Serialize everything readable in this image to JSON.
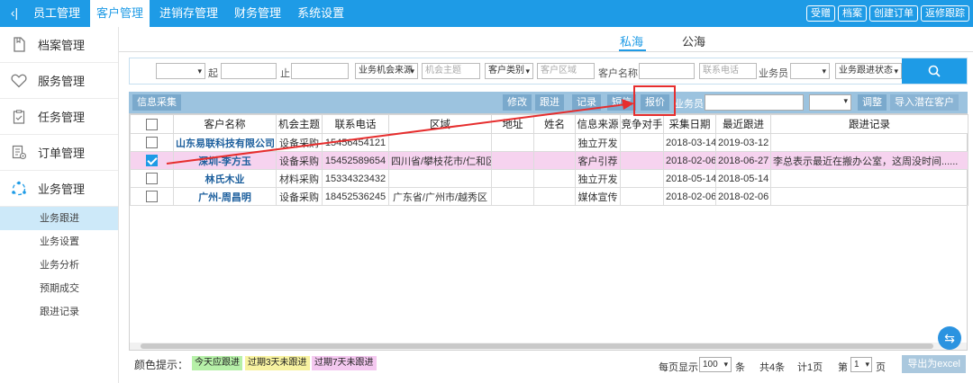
{
  "topbar": {
    "back_icon": "‹|",
    "nav": [
      "员工管理",
      "客户管理",
      "进销存管理",
      "财务管理",
      "系统设置"
    ],
    "active_nav": 1,
    "buttons": [
      "受赠",
      "档案",
      "创建订单",
      "返修跟踪"
    ]
  },
  "sidebar": {
    "items": [
      {
        "label": "档案管理",
        "icon": "document-icon"
      },
      {
        "label": "服务管理",
        "icon": "heart-icon"
      },
      {
        "label": "任务管理",
        "icon": "checklist-icon"
      },
      {
        "label": "订单管理",
        "icon": "order-icon"
      },
      {
        "label": "业务管理",
        "icon": "network-icon"
      }
    ],
    "submenu": [
      "业务跟进",
      "业务设置",
      "业务分析",
      "预期成交",
      "跟进记录"
    ]
  },
  "tabs": [
    "私海",
    "公海"
  ],
  "filter": {
    "date_from_label": "起",
    "date_to_label": "止",
    "source_select": "业务机会来源",
    "subject_placeholder": "机会主题",
    "category_select": "客户类别",
    "region_placeholder": "客户区域",
    "customer_name_label": "客户名称",
    "phone_placeholder": "联系电话",
    "salesman_label": "业务员",
    "status_select": "业务跟进状态",
    "search_icon": "search-icon"
  },
  "toolbar": {
    "collect": "信息采集",
    "edit": "修改",
    "follow": "跟进",
    "record": "记录",
    "sms": "短信",
    "quote": "报价",
    "salesman_label": "业务员",
    "adjust": "调整",
    "import_potential": "导入潜在客户"
  },
  "table": {
    "headers": [
      "客户名称",
      "机会主题",
      "联系电话",
      "区域",
      "地址",
      "姓名",
      "信息来源",
      "竞争对手",
      "采集日期",
      "最近跟进",
      "跟进记录"
    ],
    "rows": [
      {
        "checked": false,
        "highlight": false,
        "cells": [
          "山东易联科技有限公司",
          "设备采购",
          "15456454121",
          "",
          "",
          "",
          "独立开发",
          "",
          "2018-03-14",
          "2019-03-12",
          ""
        ]
      },
      {
        "checked": true,
        "highlight": true,
        "cells": [
          "深圳-李方玉",
          "设备采购",
          "15452589654",
          "四川省/攀枝花市/仁和区",
          "",
          "",
          "客户引荐",
          "",
          "2018-02-06",
          "2018-06-27",
          "李总表示最近在搬办公室，这周没时间......"
        ]
      },
      {
        "checked": false,
        "highlight": false,
        "cells": [
          "林氏木业",
          "材料采购",
          "15334323432",
          "",
          "",
          "",
          "独立开发",
          "",
          "2018-05-14",
          "2018-05-14",
          ""
        ]
      },
      {
        "checked": false,
        "highlight": false,
        "cells": [
          "广州-周昌明",
          "设备采购",
          "18452536245",
          "广东省/广州市/越秀区",
          "",
          "",
          "媒体宣传",
          "",
          "2018-02-06",
          "2018-02-06",
          ""
        ]
      }
    ]
  },
  "footer": {
    "color_hint_label": "颜色提示：",
    "chips": [
      {
        "label": "今天应跟进",
        "color": "#b6f0a8"
      },
      {
        "label": "过期3天未跟进",
        "color": "#f7f2a0"
      },
      {
        "label": "过期7天未跟进",
        "color": "#f4c8f0"
      }
    ],
    "per_page_label": "每页显示",
    "per_page_value": "100",
    "per_page_unit": "条",
    "total": "共4条",
    "pages": "计1页",
    "page_prefix": "第",
    "page_value": "1",
    "page_suffix": "页",
    "export": "导出为excel"
  }
}
